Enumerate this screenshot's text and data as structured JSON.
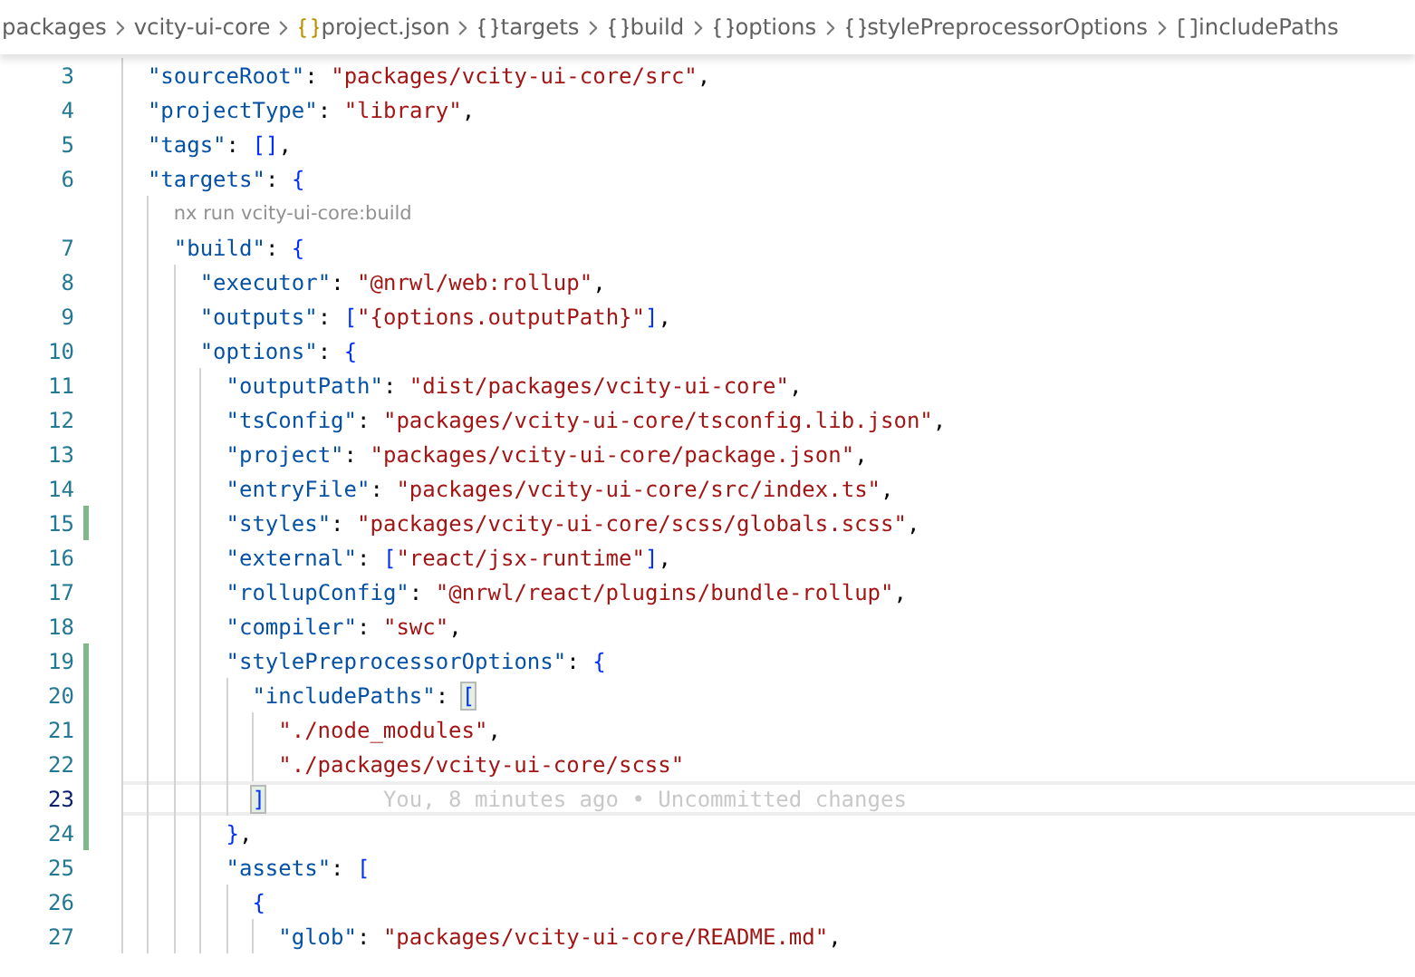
{
  "breadcrumbs": [
    {
      "label": "packages",
      "kind": "folder"
    },
    {
      "label": "vcity-ui-core",
      "kind": "folder"
    },
    {
      "label": "project.json",
      "kind": "file"
    },
    {
      "label": "targets",
      "kind": "object"
    },
    {
      "label": "build",
      "kind": "object"
    },
    {
      "label": "options",
      "kind": "object"
    },
    {
      "label": "stylePreprocessorOptions",
      "kind": "object"
    },
    {
      "label": "includePaths",
      "kind": "array"
    }
  ],
  "lines": [
    {
      "kind": "code",
      "number": "3",
      "text": "  \"sourceRoot\": \"packages/vcity-ui-core/src\",",
      "modified": false,
      "active": false
    },
    {
      "kind": "code",
      "number": "4",
      "text": "  \"projectType\": \"library\",",
      "modified": false,
      "active": false
    },
    {
      "kind": "code",
      "number": "5",
      "text": "  \"tags\": [],",
      "modified": false,
      "active": false
    },
    {
      "kind": "code",
      "number": "6",
      "text": "  \"targets\": {",
      "modified": false,
      "active": false
    },
    {
      "kind": "codelens",
      "text": "nx run vcity-ui-core:build"
    },
    {
      "kind": "code",
      "number": "7",
      "text": "    \"build\": {",
      "modified": false,
      "active": false
    },
    {
      "kind": "code",
      "number": "8",
      "text": "      \"executor\": \"@nrwl/web:rollup\",",
      "modified": false,
      "active": false
    },
    {
      "kind": "code",
      "number": "9",
      "text": "      \"outputs\": [\"{options.outputPath}\"],",
      "modified": false,
      "active": false
    },
    {
      "kind": "code",
      "number": "10",
      "text": "      \"options\": {",
      "modified": false,
      "active": false
    },
    {
      "kind": "code",
      "number": "11",
      "text": "        \"outputPath\": \"dist/packages/vcity-ui-core\",",
      "modified": false,
      "active": false
    },
    {
      "kind": "code",
      "number": "12",
      "text": "        \"tsConfig\": \"packages/vcity-ui-core/tsconfig.lib.json\",",
      "modified": false,
      "active": false
    },
    {
      "kind": "code",
      "number": "13",
      "text": "        \"project\": \"packages/vcity-ui-core/package.json\",",
      "modified": false,
      "active": false
    },
    {
      "kind": "code",
      "number": "14",
      "text": "        \"entryFile\": \"packages/vcity-ui-core/src/index.ts\",",
      "modified": false,
      "active": false
    },
    {
      "kind": "code",
      "number": "15",
      "text": "        \"styles\": \"packages/vcity-ui-core/scss/globals.scss\",",
      "modified": true,
      "active": false
    },
    {
      "kind": "code",
      "number": "16",
      "text": "        \"external\": [\"react/jsx-runtime\"],",
      "modified": false,
      "active": false
    },
    {
      "kind": "code",
      "number": "17",
      "text": "        \"rollupConfig\": \"@nrwl/react/plugins/bundle-rollup\",",
      "modified": false,
      "active": false
    },
    {
      "kind": "code",
      "number": "18",
      "text": "        \"compiler\": \"swc\",",
      "modified": false,
      "active": false
    },
    {
      "kind": "code",
      "number": "19",
      "text": "        \"stylePreprocessorOptions\": {",
      "modified": true,
      "active": false
    },
    {
      "kind": "code",
      "number": "20",
      "text": "          \"includePaths\": [",
      "modified": true,
      "active": false,
      "bracket_match": true
    },
    {
      "kind": "code",
      "number": "21",
      "text": "            \"./node_modules\",",
      "modified": true,
      "active": false
    },
    {
      "kind": "code",
      "number": "22",
      "text": "            \"./packages/vcity-ui-core/scss\"",
      "modified": true,
      "active": false
    },
    {
      "kind": "code",
      "number": "23",
      "text": "          ]",
      "modified": true,
      "active": true,
      "bracket_match": true,
      "annotation": "You, 8 minutes ago • Uncommitted changes"
    },
    {
      "kind": "code",
      "number": "24",
      "text": "        },",
      "modified": true,
      "active": false
    },
    {
      "kind": "code",
      "number": "25",
      "text": "        \"assets\": [",
      "modified": false,
      "active": false
    },
    {
      "kind": "code",
      "number": "26",
      "text": "          {",
      "modified": false,
      "active": false
    },
    {
      "kind": "code",
      "number": "27",
      "text": "            \"glob\": \"packages/vcity-ui-core/README.md\",",
      "modified": false,
      "active": false
    }
  ]
}
